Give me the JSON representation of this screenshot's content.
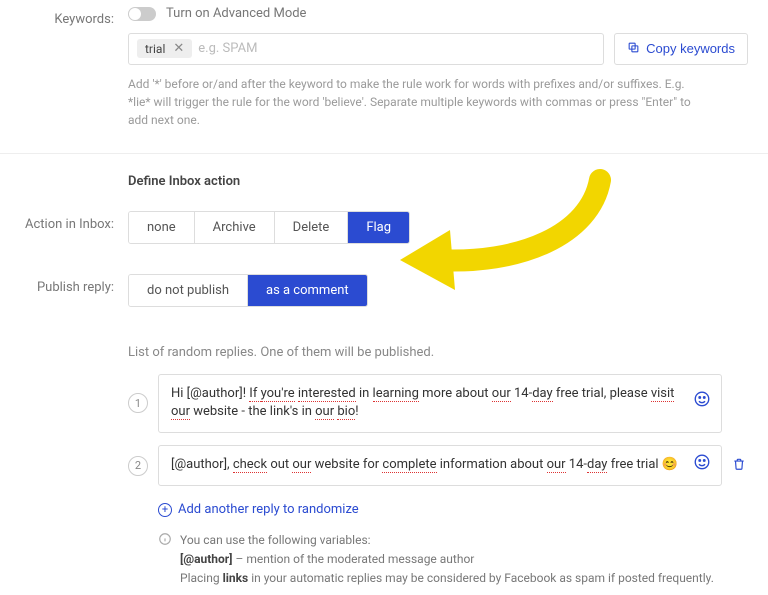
{
  "labels": {
    "keywords": "Keywords:",
    "action": "Action in Inbox:",
    "publish": "Publish reply:"
  },
  "toggle": {
    "label": "Turn on Advanced Mode"
  },
  "keywords": {
    "chip": "trial",
    "placeholder": "e.g. SPAM",
    "copy": "Copy keywords",
    "help": "Add '*' before or/and after the keyword to make the rule work for words with prefixes and/or suffixes. E.g. *lie* will trigger the rule for the word 'believe'. Separate multiple keywords with commas or press \"Enter\" to add next one."
  },
  "section": {
    "define": "Define Inbox action"
  },
  "action_options": {
    "none": "none",
    "archive": "Archive",
    "delete": "Delete",
    "flag": "Flag"
  },
  "publish_options": {
    "no": "do not publish",
    "comment": "as a comment"
  },
  "replies": {
    "desc": "List of random replies. One of them will be published.",
    "add": "Add another reply to randomize",
    "num1": "1",
    "num2": "2",
    "r1a": "Hi [@author]! ",
    "r1b": "If ",
    "r1c": "you're",
    "r1d": " ",
    "r1e": "interested",
    "r1f": " in ",
    "r1g": "learning",
    "r1h": " more about ",
    "r1i": "our",
    "r1j": " 14-",
    "r1k": "day",
    "r1l": " free trial, please ",
    "r1m": "visit",
    "r1n": " ",
    "r1o": "our",
    "r1p": " website - the link's in ",
    "r1q": "our",
    "r1r": " ",
    "r1s": "bio",
    "r1t": "!",
    "r2a": "[@author], ",
    "r2b": "check",
    "r2c": " out ",
    "r2d": "our",
    "r2e": " website for ",
    "r2f": "complete",
    "r2g": " information about ",
    "r2h": "our",
    "r2i": " 14-",
    "r2j": "day",
    "r2k": " free trial 😊"
  },
  "info": {
    "l1": "You can use the following variables:",
    "l2a": "[@author]",
    "l2b": " – mention of the moderated message author",
    "l3a": "Placing ",
    "l3b": "links",
    "l3c": " in your automatic replies may be considered by Facebook as spam if posted frequently."
  }
}
